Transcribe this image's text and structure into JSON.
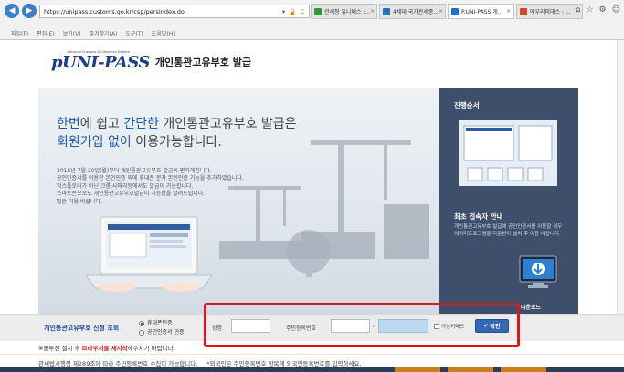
{
  "browser": {
    "url": "https://unipass.customs.go.kr/csp/persIndex.do",
    "address_controls": "▾ 🔒 C",
    "tabs": [
      {
        "label": "관세청 유니패스 :...",
        "favicon_color": "#2a9d3a",
        "active": false
      },
      {
        "label": "4세대 국가관세종...",
        "favicon_color": "#1e73c8",
        "active": false
      },
      {
        "label": "P.UNI-PASS 개...",
        "favicon_color": "#1e73c8",
        "active": true
      },
      {
        "label": "에우리피데스 : ...",
        "favicon_color": "#d9472b",
        "active": false
      }
    ],
    "tab_close": "×",
    "menu": [
      "파일(F)",
      "편집(E)",
      "보기(V)",
      "즐겨찾기(A)",
      "도구(T)",
      "도움말(H)"
    ],
    "window_icons": [
      "⌂",
      "☆",
      "⚙",
      "☺"
    ]
  },
  "header": {
    "logo_text": "pUNI-PASS",
    "logo_subtext": "Personal Customs & Clearance System",
    "title": "개인통관고유부호 발급"
  },
  "hero": {
    "headline_line1_a": "한번",
    "headline_line1_b": "에 쉽고 ",
    "headline_line1_c": "간단한",
    "headline_line1_d": " 개인통관고유부호 발급은",
    "headline_line2_a": "회원가입 없이",
    "headline_line2_b": " 이용가능합니다.",
    "desc_lines": [
      "2015년 7월 20일(월)부터 개인통관고유부호 발급이 편리해집니다.",
      "공인인증서를 이용한 본인인증 외에 휴대폰 문자 본인인증 기능을 추가하였습니다.",
      "익스플로러가 아닌 크롬,사파리등에서도 발급이 가능합니다.",
      "스마트폰으로도 개인통관고유부호발급이 가능함을 알려드립니다.",
      "많은 이용 바랍니다."
    ]
  },
  "sidebar": {
    "progress_title": "진행순서",
    "guide_title": "최초 접속자 안내",
    "guide_desc": "개인통관고유부호 발급에 공인인증서를 이용할 경우 에러미프로그램을 다운받아 설치 후 이용 바랍니다.",
    "download_label": "다운로드"
  },
  "form": {
    "section_title": "개인통관고유부호 신청 조회",
    "radio_options": [
      {
        "label": "휴대폰인증",
        "selected": true
      },
      {
        "label": "공인인증서 인증",
        "selected": false
      }
    ],
    "name_label": "성명",
    "name_value": "",
    "rrn_label": "주민등록번호",
    "rrn_front_value": "",
    "rrn_dash": "-",
    "rrn_back_value": "",
    "virtual_keypad_label": "가상키패드",
    "virtual_keypad_checked": false,
    "confirm_label": "확인",
    "highlight_color": "#e01616"
  },
  "notice": {
    "prefix": "※솔루션 설치 후 ",
    "emphasis": "브라우저를 재시작",
    "suffix": "해주시기 바랍니다."
  },
  "footer": {
    "law_text": "관세법시행령 제289조에 따라 주민등록번호 수집이 가능합니다.",
    "foreigner_text": "*외국인은 주민등록번호 항목에 외국인등록번호를 입력하세요."
  }
}
